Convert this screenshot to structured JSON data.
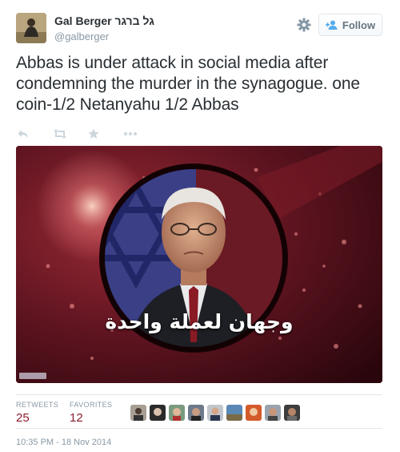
{
  "user": {
    "name": "Gal Berger גל ברגר",
    "handle": "@galberger"
  },
  "follow_button": {
    "label": "Follow"
  },
  "tweet": {
    "text": "Abbas is under attack in social media after condemning the murder in the synagogue. one coin-1/2 Netanyahu 1/2 Abbas"
  },
  "actions": [
    "reply-icon",
    "retweet-icon",
    "favorite-icon",
    "more-icon"
  ],
  "media": {
    "caption": "وجهان لعملة واحدة"
  },
  "stats": {
    "retweets_label": "RETWEETS",
    "retweets_count": "25",
    "favorites_label": "FAVORITES",
    "favorites_count": "12"
  },
  "timestamp": "10:35 PM - 18 Nov 2014",
  "colors": {
    "stat_count": "#8c1b2c",
    "muted": "#8899a6",
    "text": "#292f33",
    "media_bg": "#3a0a12"
  }
}
